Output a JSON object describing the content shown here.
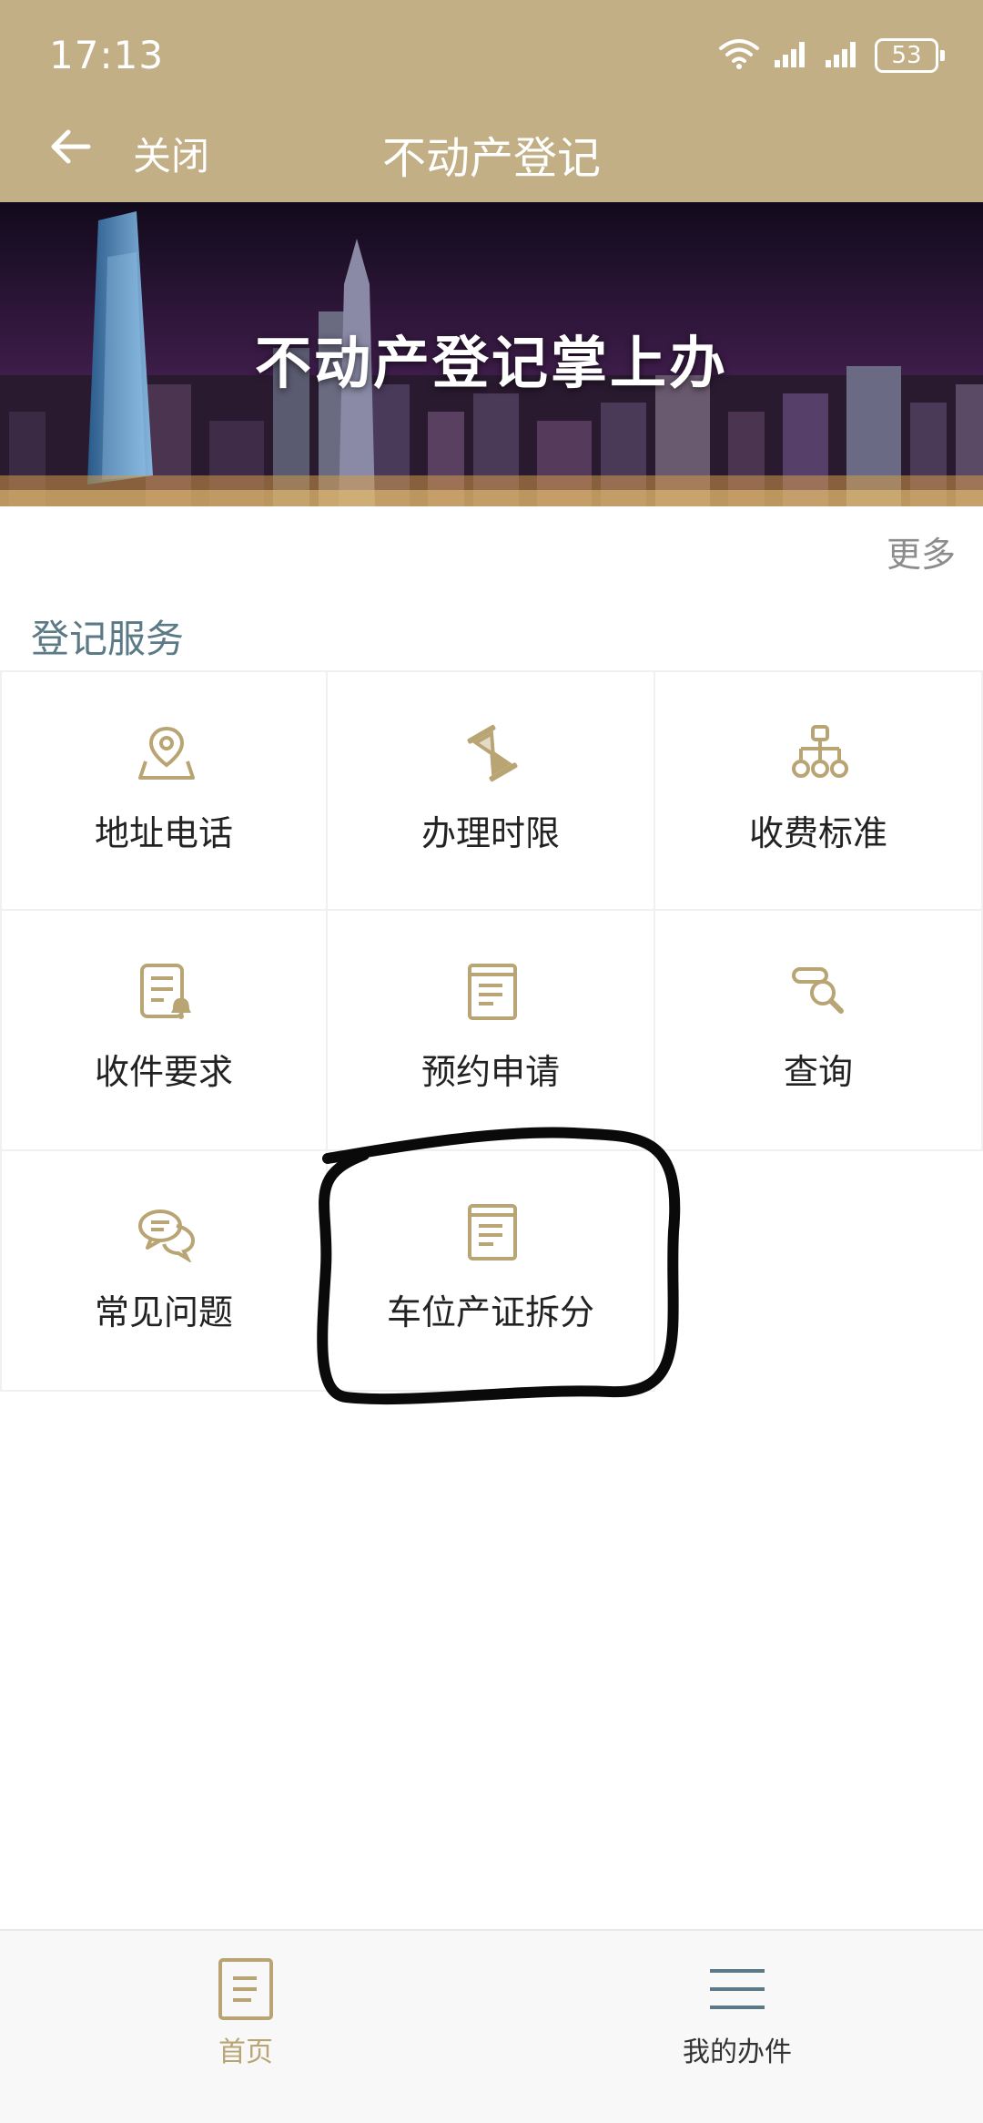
{
  "status_bar": {
    "time": "17:13",
    "battery": "53"
  },
  "header": {
    "close_label": "关闭",
    "title": "不动产登记"
  },
  "banner": {
    "text": "不动产登记掌上办"
  },
  "more_label": "更多",
  "section_title": "登记服务",
  "services": [
    {
      "label": "地址电话",
      "icon": "location-pin-icon"
    },
    {
      "label": "办理时限",
      "icon": "hourglass-icon"
    },
    {
      "label": "收费标准",
      "icon": "org-chart-icon"
    },
    {
      "label": "收件要求",
      "icon": "document-bell-icon"
    },
    {
      "label": "预约申请",
      "icon": "document-list-icon"
    },
    {
      "label": "查询",
      "icon": "search-icon"
    },
    {
      "label": "常见问题",
      "icon": "chat-bubbles-icon"
    },
    {
      "label": "车位产证拆分",
      "icon": "document-list-icon"
    }
  ],
  "bottom_nav": [
    {
      "label": "首页",
      "active": true,
      "icon": "home-document-icon"
    },
    {
      "label": "我的办件",
      "active": false,
      "icon": "menu-lines-icon"
    }
  ],
  "colors": {
    "header_bg": "#c2af86",
    "icon_gold": "#b9a474",
    "nav_active": "#b9a474",
    "nav_inactive": "#333333",
    "section_title": "#5b7a86"
  }
}
